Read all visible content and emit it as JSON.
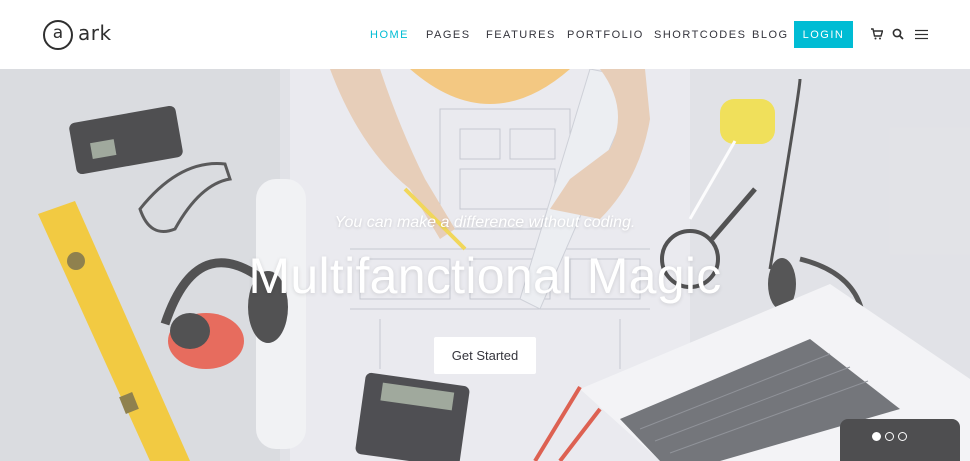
{
  "brand": {
    "logo_letter": "a",
    "name": "ark"
  },
  "nav": {
    "items": [
      {
        "label": "HOME",
        "active": true
      },
      {
        "label": "PAGES",
        "active": false
      },
      {
        "label": "FEATURES",
        "active": false
      },
      {
        "label": "PORTFOLIO",
        "active": false
      },
      {
        "label": "SHORTCODES",
        "active": false
      },
      {
        "label": "BLOG",
        "active": false
      }
    ],
    "login_label": "LOGIN",
    "icons": [
      "cart-icon",
      "search-icon",
      "menu-icon"
    ]
  },
  "hero": {
    "tagline": "You can make a difference without coding.",
    "headline": "Multifanctional Magic",
    "cta_label": "Get Started",
    "slide_count": 3,
    "active_slide": 1
  },
  "colors": {
    "accent": "#00bcd4",
    "text_dark": "#34343c",
    "white": "#ffffff"
  }
}
